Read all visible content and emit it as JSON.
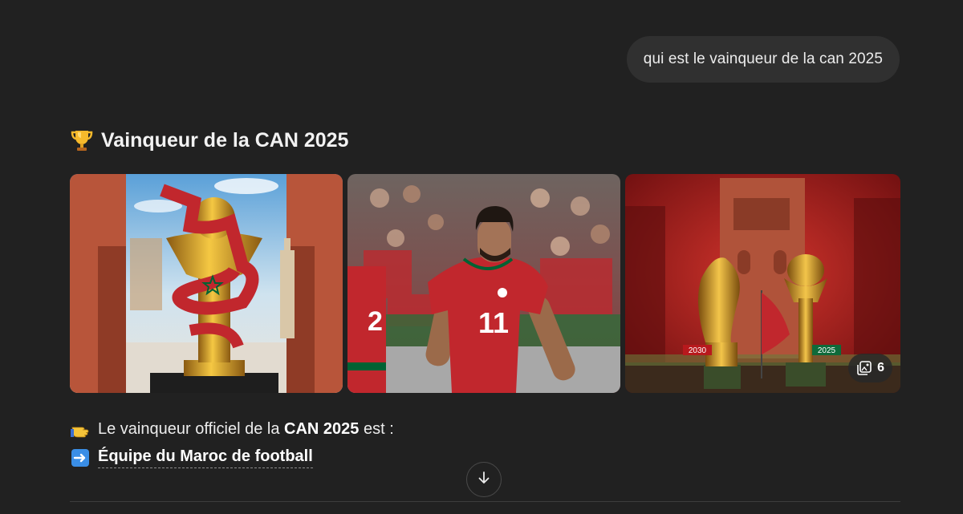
{
  "user_message": {
    "text": "qui est le vainqueur de la can 2025"
  },
  "answer": {
    "title": "Vainqueur de la CAN 2025",
    "title_icon": "trophy-icon",
    "gallery": {
      "images": [
        {
          "name": "can-trophy-morocco-flag-image"
        },
        {
          "name": "morocco-player-number-11-image"
        },
        {
          "name": "world-cup-and-can-trophies-image"
        }
      ],
      "jersey_numbers": [
        "2",
        "11"
      ],
      "trophy_tags": [
        "2030",
        "2025"
      ],
      "more_count": "6"
    },
    "line1": {
      "icon": "pointing-hand-icon",
      "prefix": "Le vainqueur officiel de la ",
      "bold": "CAN 2025",
      "suffix": " est :"
    },
    "line2": {
      "icon": "right-arrow-icon",
      "winner": "Équipe du Maroc de football"
    }
  },
  "colors": {
    "background": "#212121",
    "bubble": "#303030",
    "morocco_red": "#c1272d",
    "morocco_green": "#006233"
  }
}
